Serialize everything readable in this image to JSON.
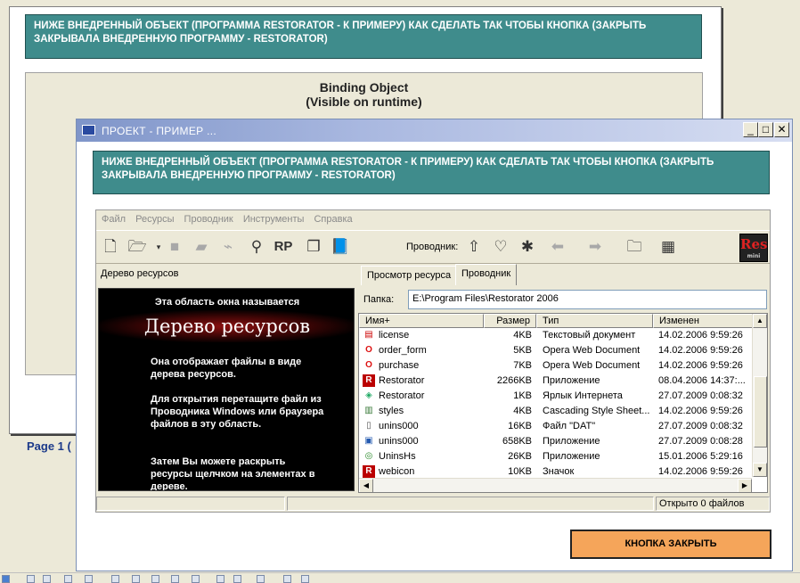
{
  "banner_text": "НИЖЕ ВНЕДРЕННЫЙ ОБЪЕКТ (ПРОГРАММА RESTORATOR - К ПРИМЕРУ) КАК СДЕЛАТЬ ТАК ЧТОБЫ КНОПКА (ЗАКРЫТЬ ЗАКРЫВАЛА ВНЕДРЕННУЮ ПРОГРАММУ - RESTORATOR)",
  "background_page": {
    "binding_title": "Binding Object",
    "binding_subtitle": "(Visible on runtime)",
    "page_label": "Page 1 ("
  },
  "window": {
    "title": "ПРОЕКТ - ПРИМЕР ...",
    "minimize": "_",
    "maximize": "□",
    "close": "✕",
    "close_button_label": "КНОПКА ЗАКРЫТЬ"
  },
  "restorator": {
    "menu": [
      "Файл",
      "Ресурсы",
      "Проводник",
      "Инструменты",
      "Справка"
    ],
    "explorer_label": "Проводник:",
    "logo_text": "Res",
    "logo_sub": "mini",
    "tree_caption": "Дерево ресурсов",
    "tree_panel": {
      "subtitle": "Эта область окна называется",
      "heading": "Дерево ресурсов",
      "para1": "Она отображает файлы в виде дерева ресурсов.",
      "para2": "Для открытия перетащите файл из Проводника Windows или браузера файлов в эту область.",
      "para3": "Затем Вы можете раскрыть ресурсы щелчком на элементах в дереве."
    },
    "tabs": [
      "Просмотр ресурса",
      "Проводник"
    ],
    "folder_label": "Папка:",
    "folder_path": "E:\\Program Files\\Restorator 2006",
    "columns": [
      "Имя+",
      "Размер",
      "Тип",
      "Изменен"
    ],
    "files": [
      {
        "name": "license",
        "size": "4KB",
        "type": "Текстовый документ",
        "modified": "14.02.2006 9:59:26",
        "icon": "text-doc-icon"
      },
      {
        "name": "order_form",
        "size": "5KB",
        "type": "Opera Web Document",
        "modified": "14.02.2006 9:59:26",
        "icon": "opera-icon"
      },
      {
        "name": "purchase",
        "size": "7KB",
        "type": "Opera Web Document",
        "modified": "14.02.2006 9:59:26",
        "icon": "opera-icon"
      },
      {
        "name": "Restorator",
        "size": "2266KB",
        "type": "Приложение",
        "modified": "08.04.2006 14:37:...",
        "icon": "restorator-icon"
      },
      {
        "name": "Restorator",
        "size": "1KB",
        "type": "Ярлык Интернета",
        "modified": "27.07.2009 0:08:32",
        "icon": "internet-shortcut-icon"
      },
      {
        "name": "styles",
        "size": "4KB",
        "type": "Cascading Style Sheet...",
        "modified": "14.02.2006 9:59:26",
        "icon": "css-icon"
      },
      {
        "name": "unins000",
        "size": "16KB",
        "type": "Файл \"DAT\"",
        "modified": "27.07.2009 0:08:32",
        "icon": "dat-file-icon"
      },
      {
        "name": "unins000",
        "size": "658KB",
        "type": "Приложение",
        "modified": "27.07.2009 0:08:28",
        "icon": "uninstall-icon"
      },
      {
        "name": "UninsHs",
        "size": "26KB",
        "type": "Приложение",
        "modified": "15.01.2006 5:29:16",
        "icon": "uninshs-icon"
      },
      {
        "name": "webicon",
        "size": "10KB",
        "type": "Значок",
        "modified": "14.02.2006 9:59:26",
        "icon": "restorator-icon"
      }
    ],
    "status_right": "Открыто 0 файлов"
  }
}
